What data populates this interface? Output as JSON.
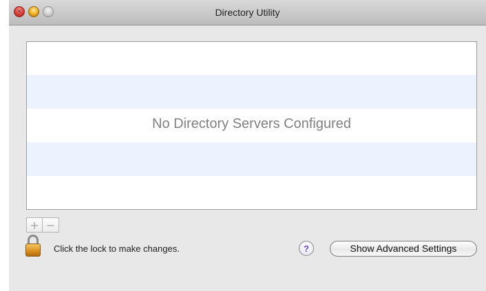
{
  "window": {
    "title": "Directory Utility"
  },
  "titlebar": {
    "close_glyph": "×"
  },
  "server_list": {
    "empty_message": "No Directory Servers Configured"
  },
  "list_controls": {
    "add_label": "+",
    "remove_label": "−"
  },
  "footer": {
    "lock_label": "Click the lock to make changes.",
    "help_label": "?",
    "advanced_button_label": "Show Advanced Settings"
  },
  "icons": {
    "lock": "lock-icon",
    "help": "help-icon"
  },
  "colors": {
    "window_background": "#e8e8e8",
    "stripe": "#edf3fe",
    "close_button": "#e0443e",
    "minimize_button": "#f3b526"
  }
}
